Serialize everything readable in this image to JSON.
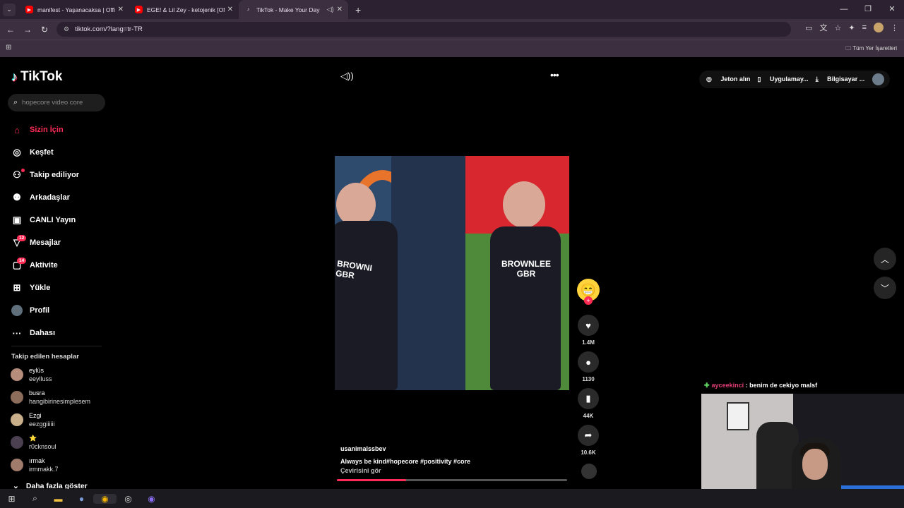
{
  "browser": {
    "tabs": [
      {
        "title": "manifest - Yaşanacaksa | Official",
        "favicon": "youtube-icon",
        "active": false
      },
      {
        "title": "EGE! & Lil Zey - ketojenik [Official",
        "favicon": "youtube-icon",
        "active": false
      },
      {
        "title": "TikTok - Make Your Day",
        "favicon": "tiktok-icon",
        "active": true
      }
    ],
    "url": "tiktok.com/?lang=tr-TR",
    "bookmarks_all": "Tüm Yer İşaretleri"
  },
  "tiktok": {
    "logo": "TikTok",
    "search_placeholder": "hopecore video core",
    "nav": [
      {
        "label": "Sizin İçin",
        "icon": "home-icon"
      },
      {
        "label": "Keşfet",
        "icon": "compass-icon"
      },
      {
        "label": "Takip ediliyor",
        "icon": "following-icon"
      },
      {
        "label": "Arkadaşlar",
        "icon": "friends-icon"
      },
      {
        "label": "CANLI Yayın",
        "icon": "live-icon"
      },
      {
        "label": "Mesajlar",
        "icon": "messages-icon",
        "badge": "12"
      },
      {
        "label": "Aktivite",
        "icon": "activity-icon",
        "badge": "14"
      },
      {
        "label": "Yükle",
        "icon": "upload-icon"
      },
      {
        "label": "Profil",
        "icon": "profile-icon"
      },
      {
        "label": "Dahası",
        "icon": "more-icon"
      }
    ],
    "following_header": "Takip edilen hesaplar",
    "following": [
      {
        "name": "eylüs",
        "username": "eeylluss"
      },
      {
        "name": "busra",
        "username": "hangibirinesimplesem"
      },
      {
        "name": "Ezgi",
        "username": "eezggiiiiii"
      },
      {
        "name": "⭐",
        "username": "r0cknsoul"
      },
      {
        "name": "ırmak",
        "username": "irmmakk.7"
      }
    ],
    "show_more": "Daha fazla göster",
    "top_actions": {
      "coins": "Jeton alın",
      "app": "Uygulamay...",
      "computer": "Bilgisayar ..."
    },
    "video": {
      "author": "usanimalssbev",
      "description": "Always be kind#hopecore  #positivity  #core",
      "translate": "Çevirisini gör",
      "likes": "1.4M",
      "comments": "1130",
      "saves": "44K",
      "shares": "10.6K",
      "progress": 0.3,
      "jersey_left": "BROWNI GBR",
      "jersey_right": "BROWNLEE GBR"
    }
  },
  "stream": {
    "chat_user": "ayceekinci",
    "chat_message": ": benim de cekiyo malsf"
  }
}
